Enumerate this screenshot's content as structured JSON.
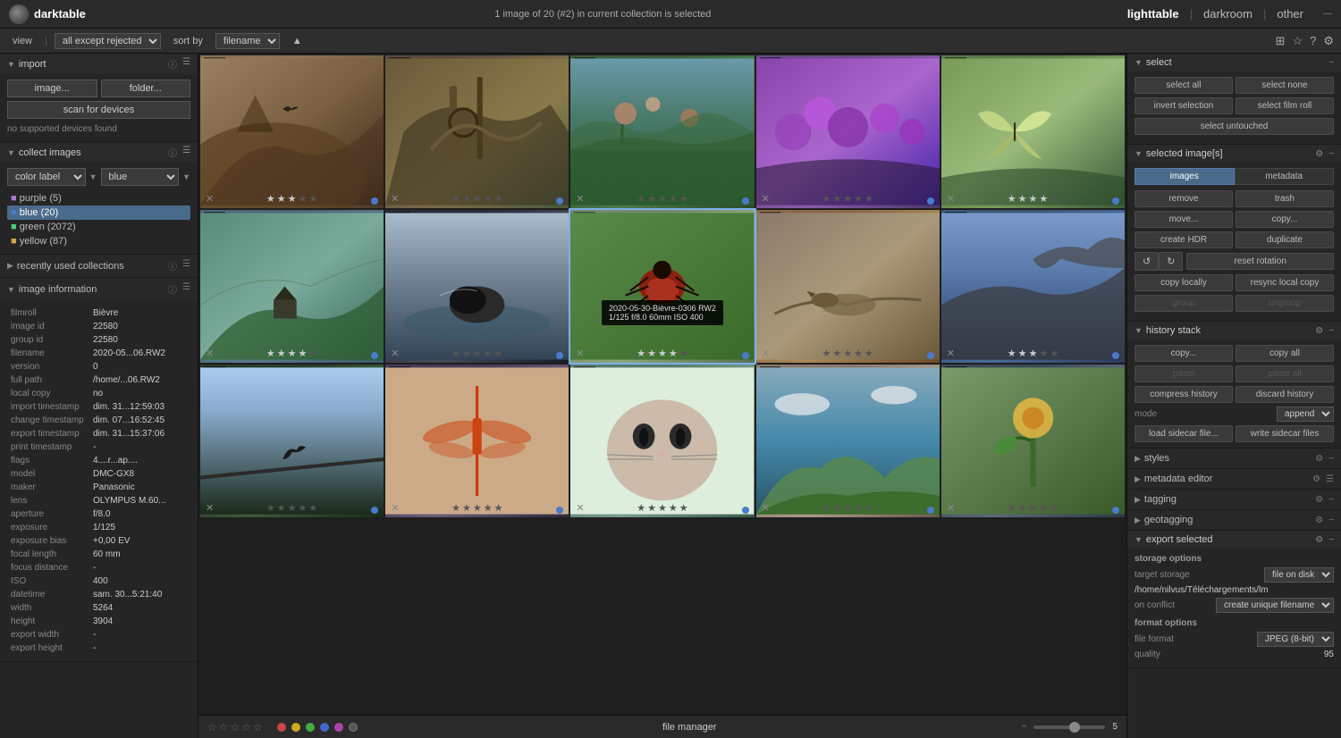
{
  "topbar": {
    "app_name": "darktable",
    "status": "1 image of 20 (#2) in current collection is selected",
    "nav_lighttable": "lighttable",
    "nav_darkroom": "darkroom",
    "nav_other": "other"
  },
  "toolbar": {
    "view_label": "view",
    "filter": "all except rejected",
    "sort_label": "sort by",
    "sort_field": "filename"
  },
  "left_panel": {
    "import_title": "import",
    "image_btn": "image...",
    "folder_btn": "folder...",
    "scan_btn": "scan for devices",
    "no_devices": "no supported devices found",
    "collect_title": "collect images",
    "filter_type": "color label",
    "filter_value": "blue",
    "collections": [
      {
        "label": "purple (5)",
        "count": 5,
        "color": "purple"
      },
      {
        "label": "blue (20)",
        "count": 20,
        "color": "blue",
        "active": true
      },
      {
        "label": "green (2072)",
        "count": 2072,
        "color": "green"
      },
      {
        "label": "yellow (87)",
        "count": 87,
        "color": "yellow"
      }
    ],
    "recently_used_title": "recently used collections",
    "image_info_title": "image information",
    "info_fields": [
      {
        "key": "filmroll",
        "value": "Bièvre"
      },
      {
        "key": "image id",
        "value": "22580"
      },
      {
        "key": "group id",
        "value": "22580"
      },
      {
        "key": "filename",
        "value": "2020-05...06.RW2"
      },
      {
        "key": "version",
        "value": "0"
      },
      {
        "key": "full path",
        "value": "/home/...06.RW2"
      },
      {
        "key": "local copy",
        "value": "no"
      },
      {
        "key": "import timestamp",
        "value": "dim. 31...12:59:03"
      },
      {
        "key": "change timestamp",
        "value": "dim. 07...16:52:45"
      },
      {
        "key": "export timestamp",
        "value": "dim. 31...15:37:06"
      },
      {
        "key": "print timestamp",
        "value": "-"
      },
      {
        "key": "flags",
        "value": "4....r...ap...."
      },
      {
        "key": "model",
        "value": "DMC-GX8"
      },
      {
        "key": "maker",
        "value": "Panasonic"
      },
      {
        "key": "lens",
        "value": "OLYMPUS M.60..."
      },
      {
        "key": "aperture",
        "value": "f/8.0"
      },
      {
        "key": "exposure",
        "value": "1/125"
      },
      {
        "key": "exposure bias",
        "value": "+0.00 EV"
      },
      {
        "key": "focal length",
        "value": "60 mm"
      },
      {
        "key": "focus distance",
        "value": "-"
      },
      {
        "key": "ISO",
        "value": "400"
      },
      {
        "key": "datetime",
        "value": "sam. 30...5:21:40"
      },
      {
        "key": "width",
        "value": "5264"
      },
      {
        "key": "height",
        "value": "3904"
      },
      {
        "key": "export width",
        "value": "-"
      },
      {
        "key": "export height",
        "value": "-"
      }
    ]
  },
  "image_grid": {
    "images": [
      {
        "id": 1,
        "format": "RW2",
        "stars": 3,
        "dot_color": "blue",
        "has_tooltip": false,
        "bg": "thumb-bg-1"
      },
      {
        "id": 2,
        "format": "RW2",
        "stars": 0,
        "dot_color": "blue",
        "has_tooltip": false,
        "bg": "thumb-bg-2"
      },
      {
        "id": 3,
        "format": "RW2",
        "stars": 0,
        "dot_color": "blue",
        "has_tooltip": false,
        "bg": "thumb-bg-3"
      },
      {
        "id": 4,
        "format": "RW2",
        "stars": 0,
        "dot_color": "blue",
        "has_tooltip": false,
        "bg": "thumb-bg-4"
      },
      {
        "id": 5,
        "format": "RW2",
        "stars": 4,
        "dot_color": "blue",
        "has_tooltip": false,
        "bg": "thumb-bg-5"
      },
      {
        "id": 6,
        "format": "RW2",
        "stars": 4,
        "dot_color": "blue",
        "has_tooltip": false,
        "bg": "thumb-bg-6"
      },
      {
        "id": 7,
        "format": "RW2",
        "stars": 0,
        "dot_color": "blue",
        "has_tooltip": false,
        "bg": "thumb-bg-7"
      },
      {
        "id": 8,
        "format": "RW2",
        "stars": 4,
        "dot_color": "blue",
        "has_tooltip": true,
        "tooltip": "2020-05-30-Bièvre-0306 RW2\n1/125 f/8.0 60mm ISO 400",
        "selected": true,
        "bg": "thumb-bg-8"
      },
      {
        "id": 9,
        "format": "RW2",
        "stars": 0,
        "dot_color": "blue",
        "has_tooltip": false,
        "bg": "thumb-bg-9"
      },
      {
        "id": 10,
        "format": "RW2",
        "stars": 3,
        "dot_color": "blue",
        "has_tooltip": false,
        "bg": "thumb-bg-10"
      },
      {
        "id": 11,
        "format": "RW2",
        "stars": 0,
        "dot_color": "blue",
        "has_tooltip": false,
        "bg": "thumb-bg-11"
      },
      {
        "id": 12,
        "format": "RW2",
        "stars": 0,
        "dot_color": "blue",
        "has_tooltip": false,
        "bg": "thumb-bg-12"
      },
      {
        "id": 13,
        "format": "RW2",
        "stars": 0,
        "dot_color": "blue",
        "has_tooltip": false,
        "bg": "thumb-bg-13"
      },
      {
        "id": 14,
        "format": "RW2",
        "stars": 0,
        "dot_color": "blue",
        "has_tooltip": false,
        "bg": "thumb-bg-14"
      },
      {
        "id": 15,
        "format": "RW2",
        "stars": 0,
        "dot_color": "blue",
        "has_tooltip": false,
        "bg": "thumb-bg-15"
      }
    ]
  },
  "bottom_bar": {
    "file_manager": "file manager",
    "zoom_value": "5"
  },
  "right_panel": {
    "select_title": "select",
    "select_all": "select all",
    "select_none": "select none",
    "invert_selection": "invert selection",
    "select_film_roll": "select film roll",
    "select_untouched": "select untouched",
    "selected_images_title": "selected image[s]",
    "tab_images": "images",
    "tab_metadata": "metadata",
    "remove_btn": "remove",
    "trash_btn": "trash",
    "move_btn": "move...",
    "copy_btn": "copy...",
    "create_hdr_btn": "create HDR",
    "duplicate_btn": "duplicate",
    "reset_rotation_btn": "reset rotation",
    "copy_locally_btn": "copy locally",
    "resync_local_copy_btn": "resync local copy",
    "group_btn": "group",
    "ungroup_btn": "ungroup",
    "history_stack_title": "history stack",
    "history_copy_btn": "copy...",
    "history_copy_all_btn": "copy all",
    "history_paste_btn": "paste",
    "history_paste_all_btn": "paste all",
    "compress_history_btn": "compress history",
    "discard_history_btn": "discard history",
    "mode_label": "mode",
    "mode_value": "append",
    "load_sidecar_btn": "load sidecar file...",
    "write_sidecar_btn": "write sidecar files",
    "styles_title": "styles",
    "metadata_editor_title": "metadata editor",
    "tagging_title": "tagging",
    "geotagging_title": "geotagging",
    "export_selected_title": "export selected",
    "storage_options_label": "storage options",
    "target_storage_label": "target storage",
    "target_storage_value": "file on disk",
    "export_path": "/home/nilvus/Téléchargements/lm",
    "on_conflict_label": "on conflict",
    "on_conflict_value": "create unique filename",
    "format_options_label": "format options",
    "file_format_label": "file format",
    "file_format_value": "JPEG (8-bit)",
    "quality_label": "quality",
    "quality_value": "95"
  }
}
